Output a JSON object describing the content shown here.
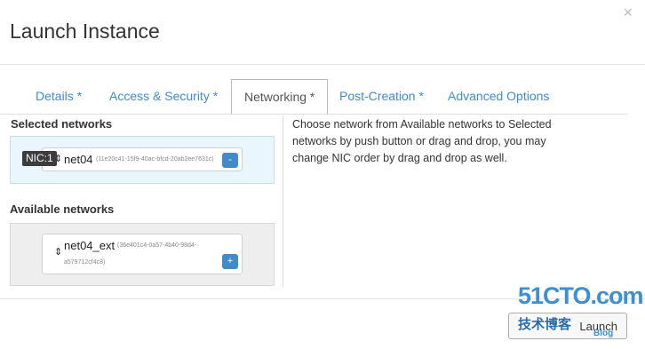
{
  "modal": {
    "title": "Launch Instance",
    "close_icon": "×"
  },
  "tabs": [
    {
      "label": "Details *",
      "active": false
    },
    {
      "label": "Access & Security *",
      "active": false
    },
    {
      "label": "Networking *",
      "active": true
    },
    {
      "label": "Post-Creation *",
      "active": false
    },
    {
      "label": "Advanced Options",
      "active": false
    }
  ],
  "selected": {
    "heading": "Selected networks",
    "badge": "NIC:1",
    "network": {
      "name": "net04",
      "id": "(11e20c41-15f9-40ac-bfcd-20ab2ee7631c)",
      "remove_label": "-"
    }
  },
  "available": {
    "heading": "Available networks",
    "network": {
      "name": "net04_ext",
      "id_line1": "(36e401c4-0a57-4b40-98d4-",
      "id_line2": "a579712cf4c8)",
      "add_label": "+"
    }
  },
  "help": {
    "text": "Choose network from Available networks to Selected networks by push button or drag and drop, you may change NIC order by drag and drop as well."
  },
  "footer": {
    "launch_label": "Launch"
  },
  "watermark": {
    "top": "51CTO.com",
    "bottom": "技术博客",
    "url": "Blog"
  },
  "colors": {
    "link": "#428bca",
    "selected_bg": "#e9f6fd",
    "available_bg": "#eeeeee"
  }
}
